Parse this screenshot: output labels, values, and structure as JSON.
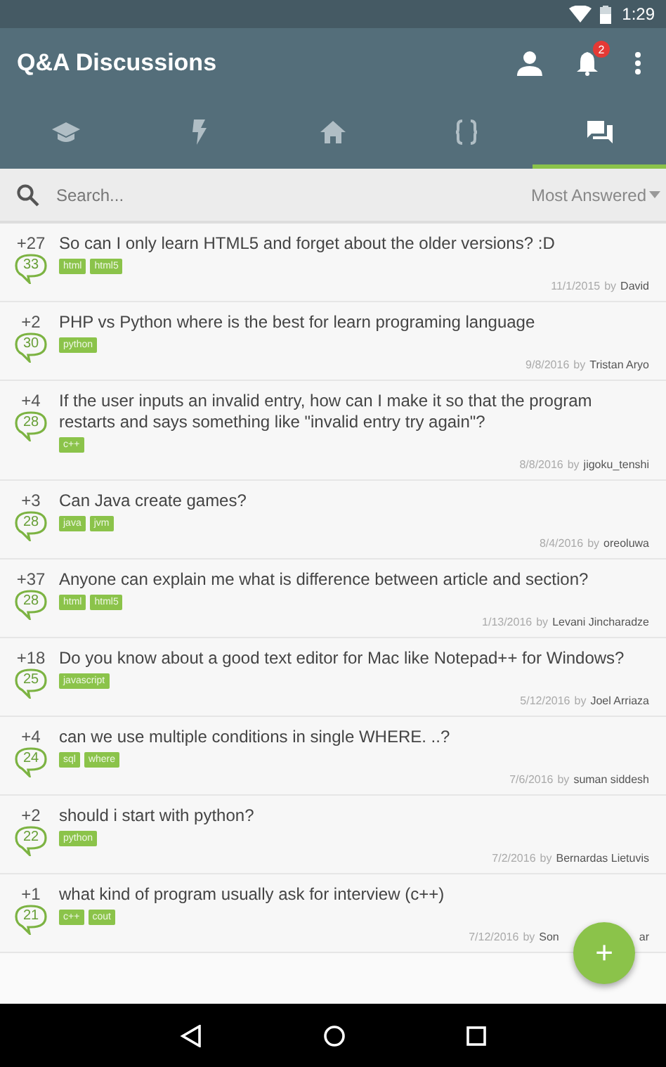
{
  "status_bar": {
    "time": "1:29"
  },
  "app_bar": {
    "title": "Q&A Discussions",
    "notification_count": "2"
  },
  "tabs": [
    {
      "selected": false
    },
    {
      "selected": false
    },
    {
      "selected": false
    },
    {
      "selected": false
    },
    {
      "selected": true
    }
  ],
  "search": {
    "placeholder": "Search...",
    "sort": "Most Answered"
  },
  "questions": [
    {
      "votes": "+27",
      "answers": "33",
      "title": "So can I only learn HTML5 and forget about the older versions? :D",
      "tags": [
        "html",
        "html5"
      ],
      "date": "11/1/2015",
      "by": "by",
      "author": "David"
    },
    {
      "votes": "+2",
      "answers": "30",
      "title": "PHP vs Python where is the best for learn programing language",
      "tags": [
        "python"
      ],
      "date": "9/8/2016",
      "by": "by",
      "author": "Tristan Aryo"
    },
    {
      "votes": "+4",
      "answers": "28",
      "title": "If the user inputs an invalid entry, how can I make it so that the program restarts and says something like \"invalid entry try again\"?",
      "tags": [
        "c++"
      ],
      "date": "8/8/2016",
      "by": "by",
      "author": "jigoku_tenshi"
    },
    {
      "votes": "+3",
      "answers": "28",
      "title": "Can Java create games?",
      "tags": [
        "java",
        "jvm"
      ],
      "date": "8/4/2016",
      "by": "by",
      "author": "oreoluwa"
    },
    {
      "votes": "+37",
      "answers": "28",
      "title": "Anyone can explain me what is difference between article and section?",
      "tags": [
        "html",
        "html5"
      ],
      "date": "1/13/2016",
      "by": "by",
      "author": "Levani Jincharadze"
    },
    {
      "votes": "+18",
      "answers": "25",
      "title": "Do you know about a good text editor for Mac like Notepad++ for Windows?",
      "tags": [
        "javascript"
      ],
      "date": "5/12/2016",
      "by": "by",
      "author": "Joel Arriaza"
    },
    {
      "votes": "+4",
      "answers": "24",
      "title": "can we use multiple conditions in single WHERE. ..?",
      "tags": [
        "sql",
        "where"
      ],
      "date": "7/6/2016",
      "by": "by",
      "author": "suman siddesh"
    },
    {
      "votes": "+2",
      "answers": "22",
      "title": "should i start with python?",
      "tags": [
        "python"
      ],
      "date": "7/2/2016",
      "by": "by",
      "author": "Bernardas Lietuvis"
    },
    {
      "votes": "+1",
      "answers": "21",
      "title": "what kind of program usually ask for interview (c++)",
      "tags": [
        "c++",
        "cout"
      ],
      "date": "7/12/2016",
      "by": "by",
      "author": "Son",
      "author_tail": "ar"
    }
  ],
  "fab": {
    "label": "+"
  }
}
